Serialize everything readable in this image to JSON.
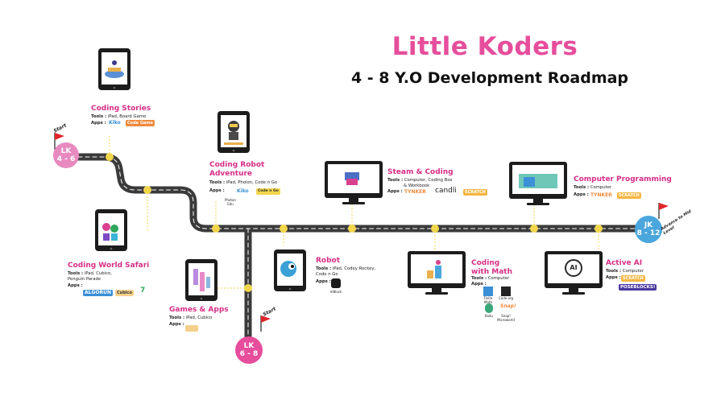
{
  "header": {
    "title": "Little Koders",
    "subtitle": "4 - 8 Y.O Development Roadmap"
  },
  "colors": {
    "pink": "#e64e9c",
    "blue": "#4aa6dc",
    "road": "#3a3a3a",
    "dot": "#f2d64b",
    "label": "#d62e86"
  },
  "markers": {
    "lk46": {
      "line1": "LK",
      "line2": "4 - 6"
    },
    "lk68": {
      "line1": "LK",
      "line2": "6 - 8"
    },
    "jk": {
      "line1": "JK",
      "line2": "8 - 12"
    },
    "start1": "Start",
    "start2": "Start",
    "advance": "Advance to Mid Level"
  },
  "stations": {
    "coding_stories": {
      "title": "Coding Stories",
      "tools_label": "Tools :",
      "tools": "iPad, Board Game",
      "apps_label": "Apps :",
      "apps": [
        "Kiko",
        "Code Game"
      ]
    },
    "robot_adventure": {
      "title1": "Coding Robot",
      "title2": "Adventure",
      "tools_label": "Tools :",
      "tools": "iPad, Pholon, Code n Go",
      "apps_label": "Apps :",
      "apps": [
        "Photon Edu",
        "Kiko",
        "Code n Go"
      ]
    },
    "world_safari": {
      "title": "Coding World Safari",
      "tools_label": "Tools :",
      "tools1": "iPad, Cubico,",
      "tools2": "Penguin Parade",
      "apps_label": "Apps :",
      "apps": [
        "ALGORUN",
        "Cubico",
        "7"
      ]
    },
    "games_apps": {
      "title": "Games & Apps",
      "tools_label": "Tools :",
      "tools": "iPad, Cubico",
      "apps_label": "Apps :"
    },
    "robot": {
      "title": "Robot",
      "tools_label": "Tools :",
      "tools1": "iPad, Codey Rockey,",
      "tools2": "Code n Go",
      "apps_label": "Apps :",
      "app_caption": "mBlock"
    },
    "steam_coding": {
      "title": "Steam & Coding",
      "tools_label": "Tools :",
      "tools1": "Computer, Coding Box",
      "tools2": "& Workbook",
      "apps_label": "Apps :",
      "apps": [
        "TYNKER",
        "candli",
        "SCRATCH"
      ]
    },
    "coding_math": {
      "title1": "Coding",
      "title2": "with Math",
      "tools_label": "Tools :",
      "tools": "Computer",
      "apps_label": "Apps :",
      "apps": [
        "Finite Math",
        "Code.org",
        "Kodu",
        "Snap! Microworld"
      ]
    },
    "computer_programming": {
      "title": "Computer Programming",
      "tools_label": "Tools :",
      "tools": "Computer",
      "apps_label": "Apps :",
      "apps": [
        "TYNKER",
        "SCRATCH"
      ]
    },
    "active_ai": {
      "title": "Active AI",
      "tools_label": "Tools :",
      "tools": "Computer",
      "apps_label": "Apps :",
      "apps": [
        "SCRATCH",
        "POSEBLOCKS!"
      ],
      "screen_text": "AI"
    }
  }
}
